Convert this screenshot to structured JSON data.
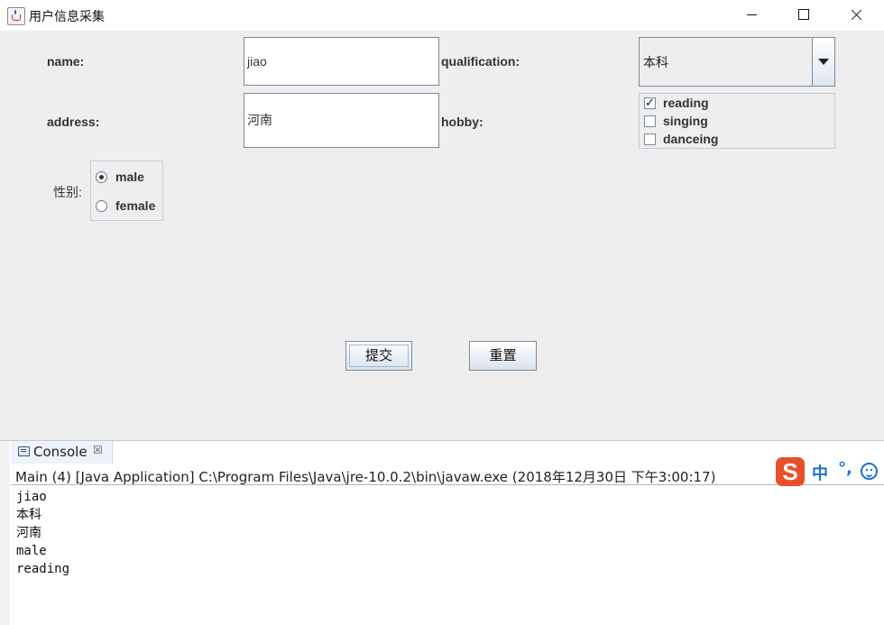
{
  "window": {
    "title": "用户信息采集"
  },
  "form": {
    "name_label": "name:",
    "name_value": "jiao",
    "qualification_label": "qualification:",
    "qualification_value": "本科",
    "address_label": "address:",
    "address_value": "河南",
    "hobby_label": "hobby:",
    "hobbies": [
      {
        "label": "reading",
        "checked": true
      },
      {
        "label": "singing",
        "checked": false
      },
      {
        "label": "danceing",
        "checked": false
      }
    ],
    "gender_label": "性别:",
    "genders": [
      {
        "label": "male",
        "selected": true
      },
      {
        "label": "female",
        "selected": false
      }
    ],
    "submit_label": "提交",
    "reset_label": "重置"
  },
  "console": {
    "tab_label": "Console",
    "close_glyph": "☒",
    "header": "Main (4) [Java Application] C:\\Program Files\\Java\\jre-10.0.2\\bin\\javaw.exe (2018年12月30日 下午3:00:17)",
    "output_lines": [
      "jiao",
      "本科",
      "河南",
      "male",
      "reading"
    ]
  },
  "ime": {
    "logo": "S",
    "mode": "中",
    "punct": "°,"
  }
}
